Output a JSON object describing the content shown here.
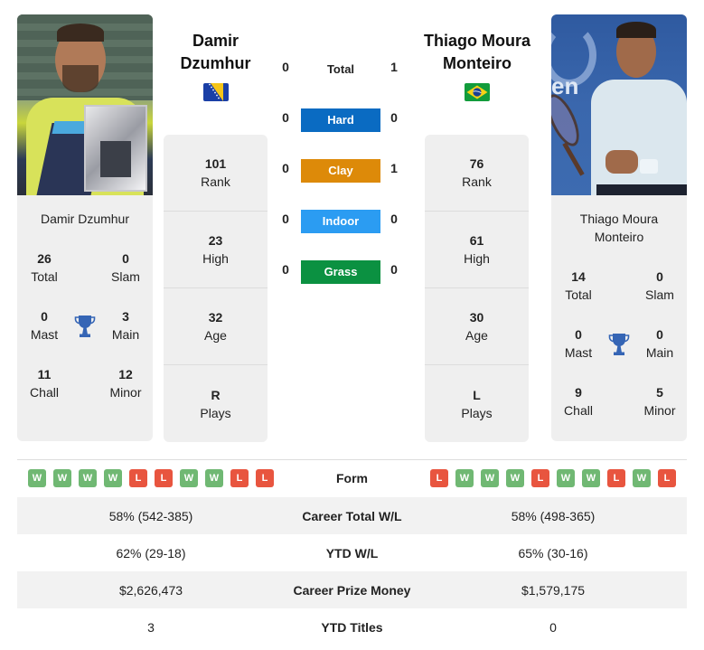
{
  "colors": {
    "hard": "#0a6bc2",
    "clay": "#dd8a09",
    "indoor": "#2b9cf2",
    "grass": "#0b9141",
    "win": "#70b873",
    "loss": "#e8553f",
    "trophy": "#3565b5"
  },
  "player1": {
    "name": "Damir Dzumhur",
    "header_line1": "Damir",
    "header_line2": "Dzumhur",
    "flag": "bosnia-herzegovina-flag",
    "photo": "player-photo",
    "titles": {
      "total": {
        "value": "26",
        "label": "Total"
      },
      "slam": {
        "value": "0",
        "label": "Slam"
      },
      "mast": {
        "value": "0",
        "label": "Mast"
      },
      "main": {
        "value": "3",
        "label": "Main"
      },
      "chall": {
        "value": "11",
        "label": "Chall"
      },
      "minor": {
        "value": "12",
        "label": "Minor"
      }
    },
    "stats": [
      {
        "value": "101",
        "label": "Rank"
      },
      {
        "value": "23",
        "label": "High"
      },
      {
        "value": "32",
        "label": "Age"
      },
      {
        "value": "R",
        "label": "Plays"
      }
    ],
    "form": [
      "W",
      "W",
      "W",
      "W",
      "L",
      "L",
      "W",
      "W",
      "L",
      "L"
    ]
  },
  "player2": {
    "name": "Thiago Moura Monteiro",
    "card_line1": "Thiago Moura",
    "card_line2": "Monteiro",
    "header_line1": "Thiago Moura",
    "header_line2": "Monteiro",
    "flag": "brazil-flag",
    "photo": "player-photo",
    "titles": {
      "total": {
        "value": "14",
        "label": "Total"
      },
      "slam": {
        "value": "0",
        "label": "Slam"
      },
      "mast": {
        "value": "0",
        "label": "Mast"
      },
      "main": {
        "value": "0",
        "label": "Main"
      },
      "chall": {
        "value": "9",
        "label": "Chall"
      },
      "minor": {
        "value": "5",
        "label": "Minor"
      }
    },
    "stats": [
      {
        "value": "76",
        "label": "Rank"
      },
      {
        "value": "61",
        "label": "High"
      },
      {
        "value": "30",
        "label": "Age"
      },
      {
        "value": "L",
        "label": "Plays"
      }
    ],
    "form": [
      "L",
      "W",
      "W",
      "W",
      "L",
      "W",
      "W",
      "L",
      "W",
      "L"
    ]
  },
  "h2h": {
    "total": {
      "label": "Total",
      "p1": "0",
      "p2": "1"
    },
    "surfaces": [
      {
        "label": "Hard",
        "p1": "0",
        "p2": "0"
      },
      {
        "label": "Clay",
        "p1": "0",
        "p2": "1"
      },
      {
        "label": "Indoor",
        "p1": "0",
        "p2": "0"
      },
      {
        "label": "Grass",
        "p1": "0",
        "p2": "0"
      }
    ]
  },
  "comparison": {
    "form_label": "Form",
    "rows": [
      {
        "label": "Career Total W/L",
        "p1": "58% (542-385)",
        "p2": "58% (498-365)"
      },
      {
        "label": "YTD W/L",
        "p1": "62% (29-18)",
        "p2": "65% (30-16)"
      },
      {
        "label": "Career Prize Money",
        "p1": "$2,626,473",
        "p2": "$1,579,175"
      },
      {
        "label": "YTD Titles",
        "p1": "3",
        "p2": "0"
      }
    ]
  }
}
